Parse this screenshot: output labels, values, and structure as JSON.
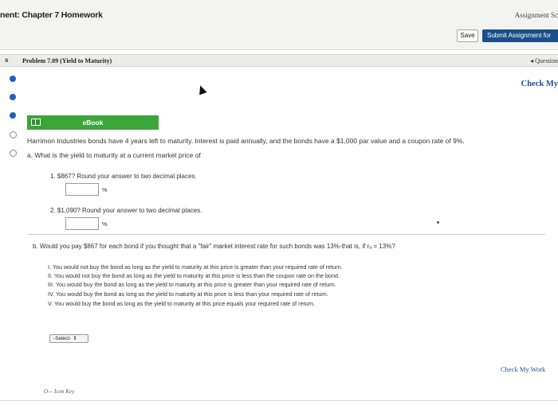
{
  "header": {
    "title": "nent: Chapter 7 Homework",
    "assignment_score": "Assignment Sc",
    "save_label": "Save",
    "submit_label": "Submit Assignment for"
  },
  "problem_bar": {
    "mark": "s",
    "title": "Problem 7.09 (Yield to Maturity)",
    "question_nav": "◂ Question"
  },
  "check_my_work_top": "Check My",
  "ebook": {
    "label": "eBook"
  },
  "problem": {
    "intro": "Harrimon Industries bonds have 4 years left to maturity. Interest is paid annually, and the bonds have a $1,000 par value and a coupon rate of 9%.",
    "part_a": "a. What is the yield to maturity at a current market price of",
    "sub1": "1. $867? Round your answer to two decimal places.",
    "sub2": "2. $1,090? Round your answer to two decimal places.",
    "pct_sign": "%",
    "part_b": "b. Would you pay $867 for each bond if you thought that a \"fair\" market interest rate for such bonds was 13%-that is, if rₐ = 13%?",
    "options": [
      "I. You would not buy the bond as long as the yield to maturity at this price is greater than your required rate of return.",
      "II. You would not buy the bond as long as the yield to maturity at this price is less than the coupon rate on the bond.",
      "III. You would buy the bond as long as the yield to maturity at this price is greater than your required rate of return.",
      "IV. You would buy the bond as long as the yield to maturity at this price is less than your required rate of return.",
      "V. You would buy the bond as long as the yield to maturity at this price equals your required rate of return."
    ],
    "select_label": "-Select- ⇕"
  },
  "footer": {
    "check_my_work": "Check My Work",
    "icon_key": "O— Icon Key"
  },
  "colors": {
    "accent_blue": "#1b4f8a",
    "ebook_green": "#3aa63a",
    "nav_dot": "#1e5fc0"
  }
}
